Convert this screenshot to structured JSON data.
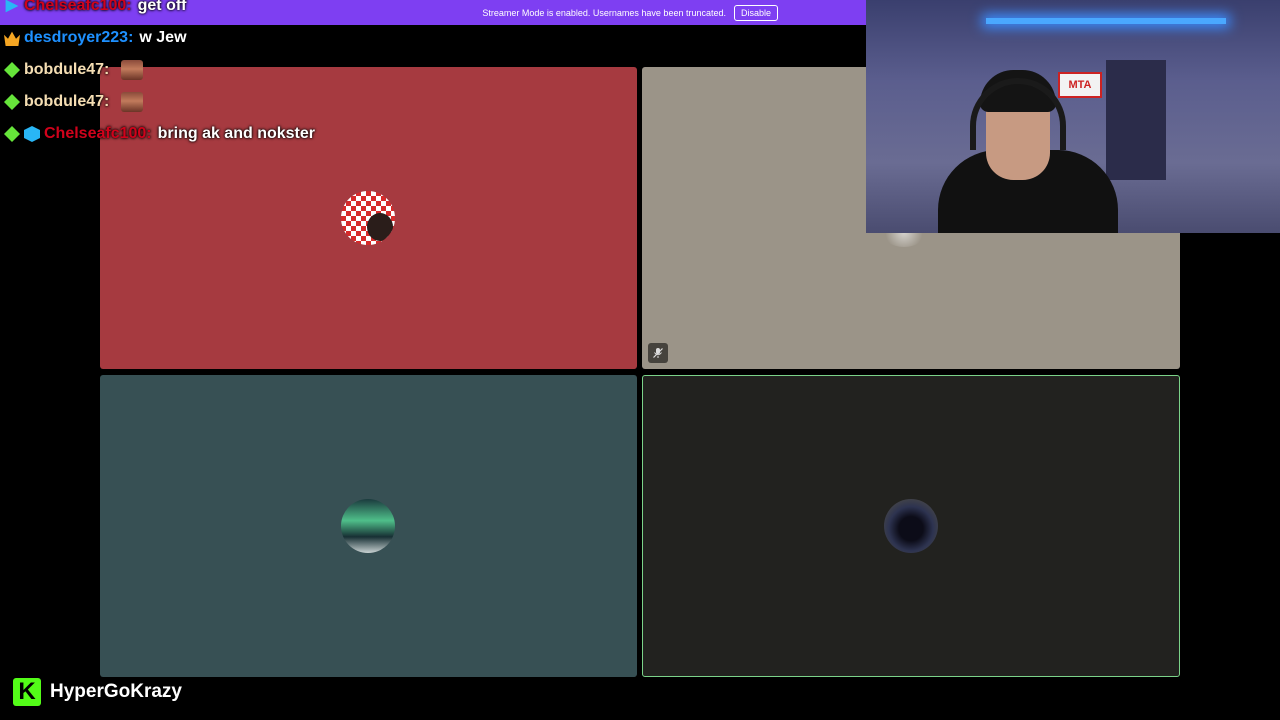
{
  "banner": {
    "text": "Streamer Mode is enabled. Usernames have been truncated.",
    "button": "Disable"
  },
  "chat": [
    {
      "badges": [
        "play-icon"
      ],
      "user": "Chelseafc100:",
      "user_color": "#d0021b",
      "message": "get off"
    },
    {
      "badges": [
        "crown-icon"
      ],
      "user": "desdroyer223:",
      "user_color": "#1e90ff",
      "message": "w Jew"
    },
    {
      "badges": [
        "gem-icon"
      ],
      "user": "bobdule47:",
      "user_color": "#f5deb3",
      "message": "",
      "emote": "face-emote"
    },
    {
      "badges": [
        "gem-icon"
      ],
      "user": "bobdule47:",
      "user_color": "#f5deb3",
      "message": "",
      "emote": "face-emote"
    },
    {
      "badges": [
        "gem-icon",
        "cube-icon"
      ],
      "user": "Chelseafc100:",
      "user_color": "#d0021b",
      "message": "bring ak and nokster"
    }
  ],
  "tiles": [
    {
      "name": "participant-tile-1",
      "color": "#a63a40",
      "avatar": "checkered-avatar"
    },
    {
      "name": "participant-tile-2",
      "color": "#9b9488",
      "avatar": "faint-avatar",
      "muted": true
    },
    {
      "name": "participant-tile-3",
      "color": "#375054",
      "avatar": "aurora-avatar"
    },
    {
      "name": "participant-tile-4",
      "color": "#22221f",
      "avatar": "wolf-avatar",
      "speaking": true
    }
  ],
  "webcam": {
    "sign": "MTA"
  },
  "logo": {
    "icon": "K",
    "name": "HyperGoKrazy"
  }
}
